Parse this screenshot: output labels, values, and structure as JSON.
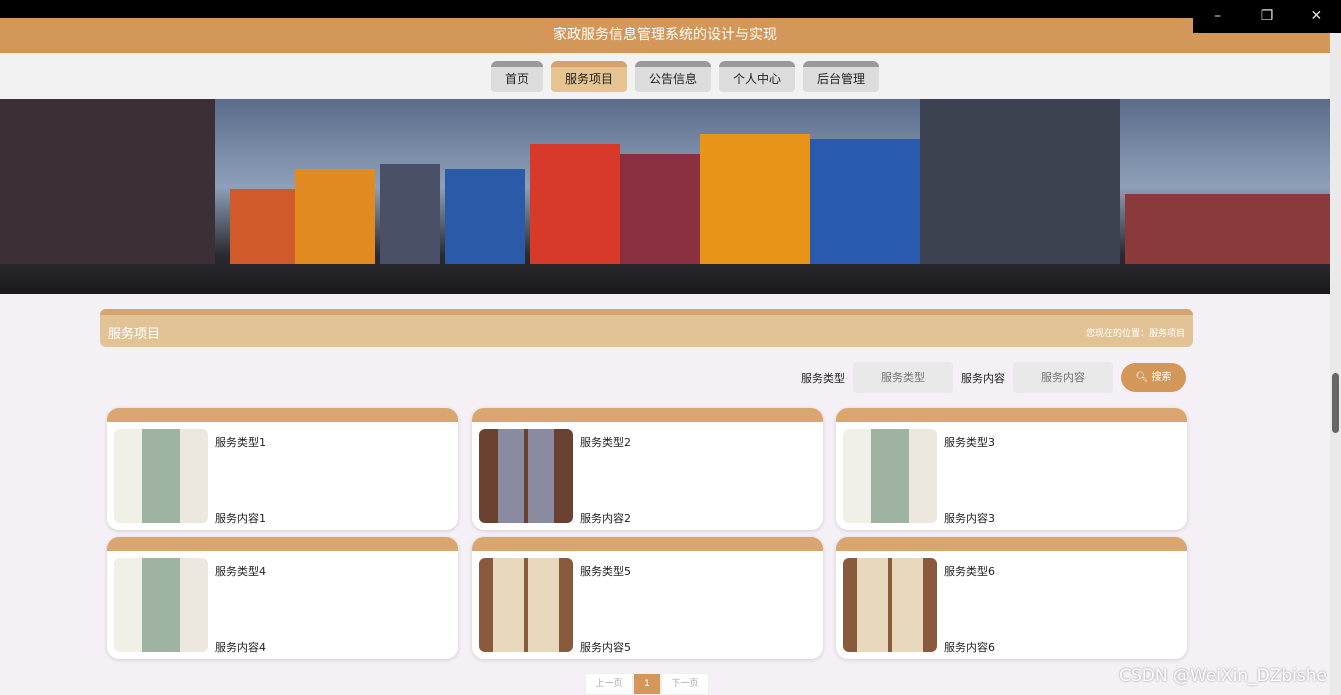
{
  "window": {
    "minimize": "–",
    "restore": "❐",
    "close": "✕"
  },
  "title": "家政服务信息管理系统的设计与实现",
  "nav": [
    {
      "label": "首页",
      "active": false
    },
    {
      "label": "服务项目",
      "active": true
    },
    {
      "label": "公告信息",
      "active": false
    },
    {
      "label": "个人中心",
      "active": false
    },
    {
      "label": "后台管理",
      "active": false
    }
  ],
  "section": {
    "title": "服务项目",
    "location": "您现在的位置：服务项目"
  },
  "search": {
    "type_label": "服务类型",
    "type_placeholder": "服务类型",
    "content_label": "服务内容",
    "content_placeholder": "服务内容",
    "button": "搜索",
    "icon": "search-icon"
  },
  "items": [
    {
      "type": "服务类型1",
      "content": "服务内容1",
      "photo": "green"
    },
    {
      "type": "服务类型2",
      "content": "服务内容2",
      "photo": "brown"
    },
    {
      "type": "服务类型3",
      "content": "服务内容3",
      "photo": "green"
    },
    {
      "type": "服务类型4",
      "content": "服务内容4",
      "photo": "green"
    },
    {
      "type": "服务类型5",
      "content": "服务内容5",
      "photo": "beige"
    },
    {
      "type": "服务类型6",
      "content": "服务内容6",
      "photo": "beige"
    }
  ],
  "pager": {
    "prev": "上一页",
    "current": "1",
    "next": "下一页"
  },
  "watermark": "CSDN @WeiXin_DZbishe",
  "colors": {
    "accent": "#d4975a",
    "section": "#e2c396"
  }
}
